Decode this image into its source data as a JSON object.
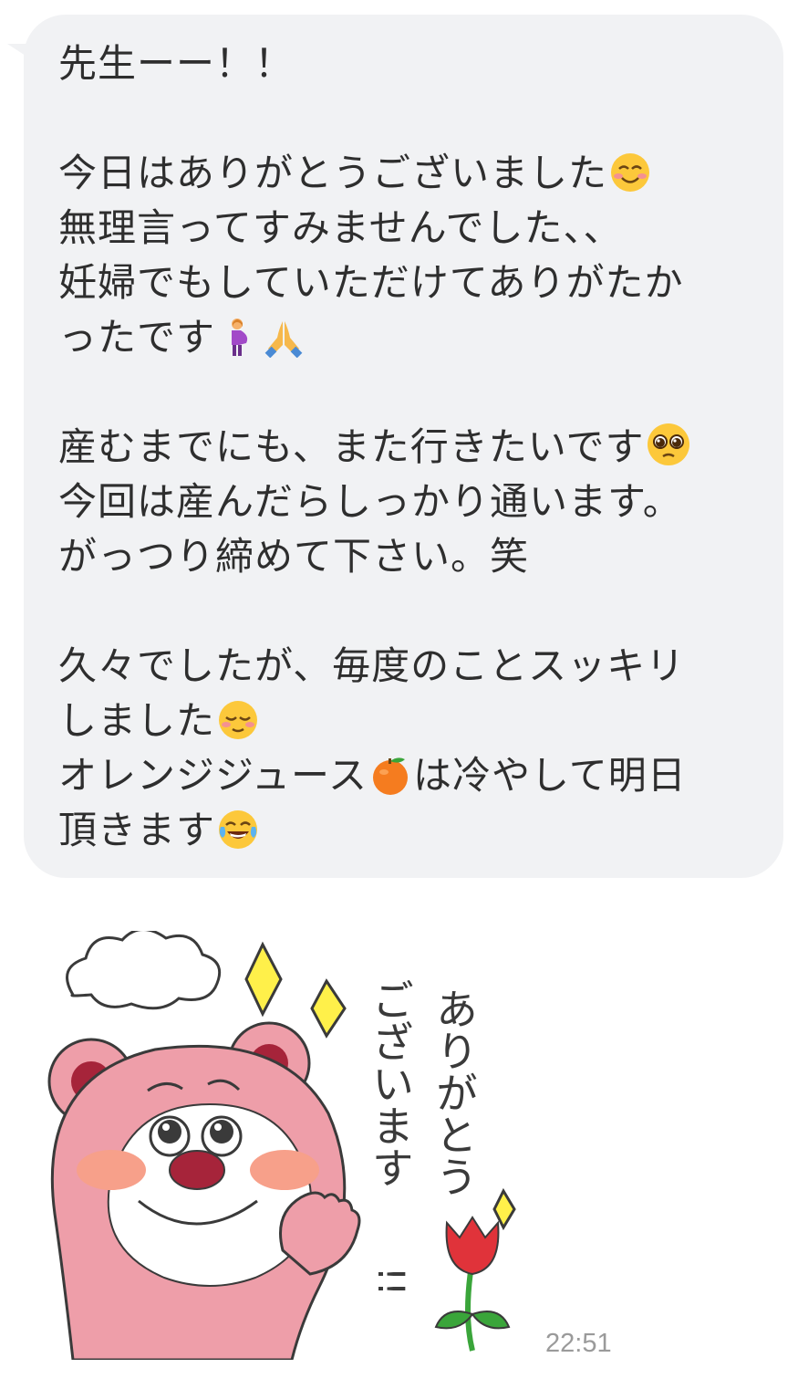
{
  "message": {
    "lines": [
      "先生ーー！！",
      "",
      "今日はありがとうございました",
      "無理言ってすみませんでした、、",
      "妊婦でもしていただけてありがたか",
      "ったです",
      "",
      "産むまでにも、また行きたいです",
      "今回は産んだらしっかり通います。",
      "がっつり締めて下さい。笑",
      "",
      "久々でしたが、毎度のことスッキリ",
      "しました",
      "オレンジジュース",
      "は冷やして明日",
      "頂きます"
    ],
    "emoji": [
      "smiling-face-with-smiling-eyes-icon",
      "pregnant-woman-icon",
      "folded-hands-icon",
      "pleading-face-icon",
      "relieved-face-icon",
      "tangerine-icon",
      "tears-of-joy-icon"
    ]
  },
  "sticker": {
    "text_line1": "ありがとう",
    "text_line2": "ございます",
    "text_line3": "!!",
    "icon": "pink-bear-sticker"
  },
  "timestamp": "22:51",
  "colors": {
    "bubble": "#f1f2f4",
    "text": "#2e2e2e",
    "timestamp": "#9a9a9a",
    "bear_pink": "#ee9ea9",
    "bear_red": "#a6243a",
    "tulip_red": "#e0333a",
    "sparkle_yellow": "#fff04a"
  }
}
